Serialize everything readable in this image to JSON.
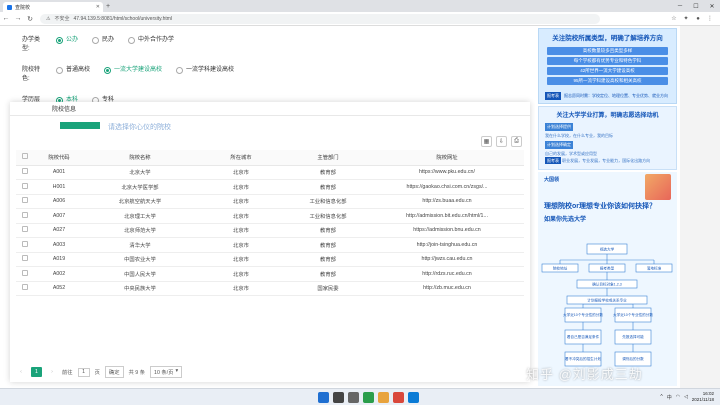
{
  "browser": {
    "tab_title": "查院校",
    "address_security": "不安全",
    "address_url": "47.94.139.5:8081/html/school/university.html"
  },
  "filters": [
    {
      "label": "办学类型:",
      "options": [
        {
          "text": "公办",
          "selected": true
        },
        {
          "text": "民办",
          "selected": false
        },
        {
          "text": "中外合作办学",
          "selected": false
        }
      ]
    },
    {
      "label": "院校特色:",
      "options": [
        {
          "text": "普通高校",
          "selected": false
        },
        {
          "text": "一流大学建设高校",
          "selected": true
        },
        {
          "text": "一流学科建设高校",
          "selected": false
        }
      ]
    },
    {
      "label": "学历层",
      "options": [
        {
          "text": "本科",
          "selected": true
        },
        {
          "text": "专科",
          "selected": false
        }
      ]
    }
  ],
  "panel": {
    "tab_label": "院校信息",
    "partial_title": "请选择你心仪的院校",
    "columns": [
      "院校代码",
      "院校名称",
      "所在城市",
      "主管部门",
      "院校网址"
    ],
    "rows": [
      [
        "A001",
        "北京大学",
        "北京市",
        "教育部",
        "https://www.pku.edu.cn/"
      ],
      [
        "H001",
        "北京大学医学部",
        "北京市",
        "教育部",
        "https://gaokao.chsi.com.cn/zsgs/..."
      ],
      [
        "A006",
        "北京航空航天大学",
        "北京市",
        "工业和信息化部",
        "http://zs.buaa.edu.cn"
      ],
      [
        "A007",
        "北京理工大学",
        "北京市",
        "工业和信息化部",
        "http://admission.bit.edu.cn/html/1..."
      ],
      [
        "A027",
        "北京师范大学",
        "北京市",
        "教育部",
        "https://admission.bnu.edu.cn"
      ],
      [
        "A003",
        "清华大学",
        "北京市",
        "教育部",
        "http://join-tsinghua.edu.cn"
      ],
      [
        "A019",
        "中国农业大学",
        "北京市",
        "教育部",
        "http://jwzs.cau.edu.cn"
      ],
      [
        "A002",
        "中国人民大学",
        "北京市",
        "教育部",
        "http://rdzs.ruc.edu.cn"
      ],
      [
        "A052",
        "中央民族大学",
        "北京市",
        "国家民委",
        "http://zb.muc.edu.cn"
      ]
    ],
    "pager": {
      "current": "1",
      "goto_label": "前往",
      "goto_value": "1",
      "page_unit": "页",
      "confirm": "确定",
      "total": "共 9 条",
      "page_size": "10 条/页"
    }
  },
  "sidebar": {
    "ad1": {
      "title": "关注院校所属类型，明确了解培养方向",
      "lines": [
        "高校数量较多且类型多样",
        "每个学校都有优势专业和特色学科",
        "42所世界一流大学建设高校",
        "95所一流学科建设高校和相关高校"
      ],
      "tag": "报考表",
      "foot": "报志愿同时需：学校定位、地理位置、专业优势、就业方向"
    },
    "ad2": {
      "title": "关注大学学业打算，明确志愿选择动机",
      "tag1": "计划选择提供",
      "line1": "我在什么学校，在什么专业，我的目标",
      "tag2": "计划选择确定",
      "line2": "自己的发展，学术型或应用型",
      "tag3": "报考表",
      "line3": "职业发展，专业发展，专业能力，国际化出路方向"
    },
    "ad3": {
      "logo": "大国领",
      "question": "理想院校or理想专业你该如何抉择？",
      "subtitle": "如果你先选大学",
      "flow": [
        "视选大学",
        "院校地址",
        "报考类型",
        "落地标准",
        "确认目标对象1,2,3",
        "计划报投学校或关系专业",
        "大学近10个专业性的分数",
        "大学近10个专业性的分数",
        "看自己是否满足条件",
        "先报选择可能",
        "看不冲突后的招生计划",
        "调剂后的分数"
      ]
    }
  },
  "watermark": "知乎 @刘影成三劫",
  "taskbar": {
    "time": "16:02",
    "date": "2021/11/18",
    "tray_ime": "中"
  },
  "colors": {
    "accent": "#1aa37a",
    "ad_blue": "#1456b8"
  }
}
